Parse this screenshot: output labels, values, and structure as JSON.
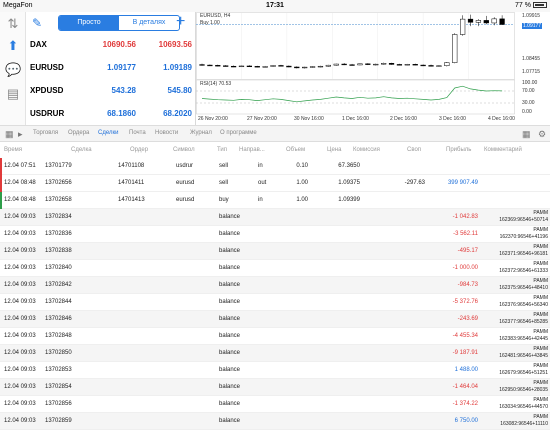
{
  "status": {
    "carrier": "MegaFon",
    "time": "17:31",
    "battery": "77 %"
  },
  "quotes": {
    "toggle_simple": "Просто",
    "toggle_details": "В деталях",
    "rows": [
      {
        "symbol": "DAX",
        "bid": "10690.56",
        "ask": "10693.56",
        "bid_color": "red",
        "ask_color": "red"
      },
      {
        "symbol": "EURUSD",
        "bid": "1.09177",
        "ask": "1.09189",
        "bid_color": "blue",
        "ask_color": "blue"
      },
      {
        "symbol": "XPDUSD",
        "bid": "543.28",
        "ask": "545.80",
        "bid_color": "blue",
        "ask_color": "blue"
      },
      {
        "symbol": "USDRUR",
        "bid": "68.1860",
        "ask": "68.2020",
        "bid_color": "blue",
        "ask_color": "blue"
      }
    ]
  },
  "chart": {
    "title": "EURUSD, H4",
    "buy_label": "Buy 1.00",
    "rsi_label": "RSI(14) 70.53",
    "price_labels": [
      "1.09915",
      "1.09177",
      "1.08455",
      "1.07715"
    ],
    "rsi_labels": [
      "100.00",
      "70.00",
      "30.00",
      "0.00"
    ],
    "date_labels": [
      "26 Nov 20:00",
      "27 Nov 20:00",
      "30 Nov 16:00",
      "1 Dec 16:00",
      "2 Dec 16:00",
      "3 Dec 16:00",
      "4 Dec 16:00"
    ]
  },
  "chart_data": {
    "type": "candlestick",
    "symbol": "EURUSD",
    "timeframe": "H4",
    "ylim": [
      1.05,
      1.1
    ],
    "candles": [
      [
        1.0605,
        1.0612,
        1.0596,
        1.0601
      ],
      [
        1.0601,
        1.0606,
        1.0594,
        1.0599
      ],
      [
        1.0599,
        1.0604,
        1.059,
        1.0596
      ],
      [
        1.0596,
        1.0601,
        1.0589,
        1.0592
      ],
      [
        1.0592,
        1.0598,
        1.0585,
        1.059
      ],
      [
        1.059,
        1.0597,
        1.0586,
        1.0594
      ],
      [
        1.0594,
        1.06,
        1.0588,
        1.0591
      ],
      [
        1.0591,
        1.0595,
        1.0583,
        1.0587
      ],
      [
        1.0587,
        1.0594,
        1.0582,
        1.059
      ],
      [
        1.059,
        1.0601,
        1.0587,
        1.0598
      ],
      [
        1.0598,
        1.0603,
        1.059,
        1.0593
      ],
      [
        1.0593,
        1.0598,
        1.0584,
        1.0586
      ],
      [
        1.0586,
        1.0591,
        1.0575,
        1.0579
      ],
      [
        1.0579,
        1.0588,
        1.0574,
        1.0585
      ],
      [
        1.0585,
        1.0592,
        1.058,
        1.0589
      ],
      [
        1.0589,
        1.0596,
        1.0583,
        1.0592
      ],
      [
        1.0592,
        1.0603,
        1.0588,
        1.06
      ],
      [
        1.06,
        1.0612,
        1.0596,
        1.0609
      ],
      [
        1.0609,
        1.0617,
        1.0601,
        1.0604
      ],
      [
        1.0604,
        1.061,
        1.0597,
        1.0602
      ],
      [
        1.0602,
        1.0614,
        1.0599,
        1.0611
      ],
      [
        1.0611,
        1.0616,
        1.0601,
        1.0605
      ],
      [
        1.0605,
        1.0612,
        1.0598,
        1.0608
      ],
      [
        1.0608,
        1.062,
        1.0604,
        1.0615
      ],
      [
        1.0615,
        1.0619,
        1.0603,
        1.0606
      ],
      [
        1.0606,
        1.0611,
        1.0598,
        1.0603
      ],
      [
        1.0603,
        1.061,
        1.0599,
        1.0607
      ],
      [
        1.0607,
        1.0612,
        1.0599,
        1.0601
      ],
      [
        1.0601,
        1.0606,
        1.0593,
        1.0598
      ],
      [
        1.0598,
        1.0605,
        1.0589,
        1.0592
      ],
      [
        1.0592,
        1.0599,
        1.0587,
        1.0596
      ],
      [
        1.0596,
        1.0625,
        1.059,
        1.062
      ],
      [
        1.062,
        1.085,
        1.0615,
        1.084
      ],
      [
        1.084,
        1.099,
        1.083,
        1.096
      ],
      [
        1.096,
        1.0995,
        1.0905,
        1.0935
      ],
      [
        1.0935,
        1.096,
        1.0905,
        1.095
      ],
      [
        1.095,
        1.0985,
        1.092,
        1.093
      ],
      [
        1.093,
        1.0975,
        1.0912,
        1.0962
      ],
      [
        1.0962,
        1.099,
        1.0915,
        1.0918
      ]
    ],
    "rsi": [
      45,
      43,
      41,
      40,
      39,
      42,
      41,
      38,
      41,
      44,
      42,
      38,
      34,
      37,
      40,
      42,
      46,
      50,
      47,
      45,
      49,
      46,
      47,
      51,
      47,
      45,
      46,
      44,
      42,
      40,
      42,
      48,
      80,
      86,
      77,
      73,
      70,
      71,
      70.53
    ]
  },
  "tabs": [
    "Торговля",
    "Ордера",
    "Сделки",
    "Почта",
    "Новости",
    "Журнал",
    "О программе"
  ],
  "columns": [
    "Время",
    "Сделка",
    "Ордер",
    "Символ",
    "Тип",
    "Направ...",
    "Объем",
    "Цена",
    "Комиссия",
    "Своп",
    "Прибыль",
    "Комментарий"
  ],
  "deals": [
    {
      "time": "12.04 07:51",
      "deal": "13701779",
      "order": "14701108",
      "symbol": "usdrur",
      "type": "sell",
      "dir": "in",
      "volume": "0.10",
      "price": "67.3650",
      "commission": "",
      "swap": "",
      "profit": "",
      "comment": "",
      "marker": "red"
    },
    {
      "time": "12.04 08:48",
      "deal": "13702656",
      "order": "14701411",
      "symbol": "eurusd",
      "type": "sell",
      "dir": "out",
      "volume": "1.00",
      "price": "1.09375",
      "commission": "",
      "swap": "-297.63",
      "profit": "399 907.49",
      "comment": "",
      "marker": "red"
    },
    {
      "time": "12.04 08:48",
      "deal": "13702658",
      "order": "14701413",
      "symbol": "eurusd",
      "type": "buy",
      "dir": "in",
      "volume": "1.00",
      "price": "1.09399",
      "commission": "",
      "swap": "",
      "profit": "",
      "comment": "",
      "marker": "green"
    },
    {
      "time": "12.04 09:03",
      "deal": "13702834",
      "order": "",
      "symbol": "",
      "type": "balance",
      "dir": "",
      "volume": "",
      "price": "",
      "commission": "",
      "swap": "",
      "profit": "-1 042.83",
      "comment": "PAMM 162369:96546+50714",
      "marker": ""
    },
    {
      "time": "12.04 09:03",
      "deal": "13702836",
      "order": "",
      "symbol": "",
      "type": "balance",
      "dir": "",
      "volume": "",
      "price": "",
      "commission": "",
      "swap": "",
      "profit": "-3 562.11",
      "comment": "PAMM 162370:96546+41196",
      "marker": ""
    },
    {
      "time": "12.04 09:03",
      "deal": "13702838",
      "order": "",
      "symbol": "",
      "type": "balance",
      "dir": "",
      "volume": "",
      "price": "",
      "commission": "",
      "swap": "",
      "profit": "-495.17",
      "comment": "PAMM 162371:96546+96181",
      "marker": ""
    },
    {
      "time": "12.04 09:03",
      "deal": "13702840",
      "order": "",
      "symbol": "",
      "type": "balance",
      "dir": "",
      "volume": "",
      "price": "",
      "commission": "",
      "swap": "",
      "profit": "-1 000.00",
      "comment": "PAMM 162372:96546+61333",
      "marker": ""
    },
    {
      "time": "12.04 09:03",
      "deal": "13702842",
      "order": "",
      "symbol": "",
      "type": "balance",
      "dir": "",
      "volume": "",
      "price": "",
      "commission": "",
      "swap": "",
      "profit": "-984.73",
      "comment": "PAMM 162375:96546+48410",
      "marker": ""
    },
    {
      "time": "12.04 09:03",
      "deal": "13702844",
      "order": "",
      "symbol": "",
      "type": "balance",
      "dir": "",
      "volume": "",
      "price": "",
      "commission": "",
      "swap": "",
      "profit": "-5 372.76",
      "comment": "PAMM 162376:96546+56340",
      "marker": ""
    },
    {
      "time": "12.04 09:03",
      "deal": "13702846",
      "order": "",
      "symbol": "",
      "type": "balance",
      "dir": "",
      "volume": "",
      "price": "",
      "commission": "",
      "swap": "",
      "profit": "-243.69",
      "comment": "PAMM 162377:96546+85285",
      "marker": ""
    },
    {
      "time": "12.04 09:03",
      "deal": "13702848",
      "order": "",
      "symbol": "",
      "type": "balance",
      "dir": "",
      "volume": "",
      "price": "",
      "commission": "",
      "swap": "",
      "profit": "-4 455.34",
      "comment": "PAMM 162383:96546+42445",
      "marker": ""
    },
    {
      "time": "12.04 09:03",
      "deal": "13702850",
      "order": "",
      "symbol": "",
      "type": "balance",
      "dir": "",
      "volume": "",
      "price": "",
      "commission": "",
      "swap": "",
      "profit": "-9 187.91",
      "comment": "PAMM 162481:96546+43845",
      "marker": ""
    },
    {
      "time": "12.04 09:03",
      "deal": "13702853",
      "order": "",
      "symbol": "",
      "type": "balance",
      "dir": "",
      "volume": "",
      "price": "",
      "commission": "",
      "swap": "",
      "profit": "1 488.00",
      "comment": "PAMM 162679:96546+51251",
      "marker": ""
    },
    {
      "time": "12.04 09:03",
      "deal": "13702854",
      "order": "",
      "symbol": "",
      "type": "balance",
      "dir": "",
      "volume": "",
      "price": "",
      "commission": "",
      "swap": "",
      "profit": "-1 464.04",
      "comment": "PAMM 162950:96546+28035",
      "marker": ""
    },
    {
      "time": "12.04 09:03",
      "deal": "13702856",
      "order": "",
      "symbol": "",
      "type": "balance",
      "dir": "",
      "volume": "",
      "price": "",
      "commission": "",
      "swap": "",
      "profit": "-1 374.22",
      "comment": "PAMM 163034:96546+44570",
      "marker": ""
    },
    {
      "time": "12.04 09:03",
      "deal": "13702859",
      "order": "",
      "symbol": "",
      "type": "balance",
      "dir": "",
      "volume": "",
      "price": "",
      "commission": "",
      "swap": "",
      "profit": "6 750.00",
      "comment": "PAMM 163082:96546+11110",
      "marker": ""
    }
  ]
}
